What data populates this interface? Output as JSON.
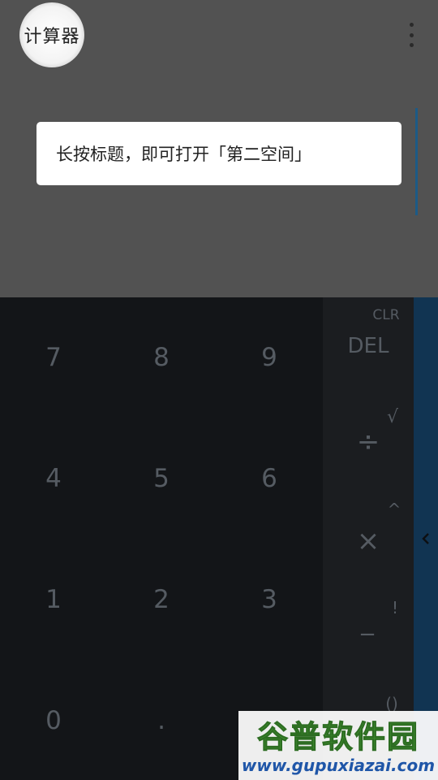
{
  "app": {
    "title": "计算器"
  },
  "display": {
    "tooltip": "长按标题，即可打开「第二空间」"
  },
  "numpad": {
    "rows": [
      [
        "7",
        "8",
        "9"
      ],
      [
        "4",
        "5",
        "6"
      ],
      [
        "1",
        "2",
        "3"
      ],
      [
        "0",
        ".",
        ""
      ]
    ]
  },
  "operators": {
    "clr": "CLR",
    "del": "DEL",
    "sqrt": "√",
    "divide": "÷",
    "power": "^",
    "multiply": "×",
    "factorial": "!",
    "minus": "−",
    "parens": "()"
  },
  "watermark": {
    "title": "谷普软件园",
    "url": "www.gupuxiazai.com"
  },
  "colors": {
    "display_bg": "#525252",
    "pad_bg": "#131518",
    "ops_bg": "#1b1d20",
    "advanced_bg": "#113452",
    "key_text": "#555b62"
  }
}
